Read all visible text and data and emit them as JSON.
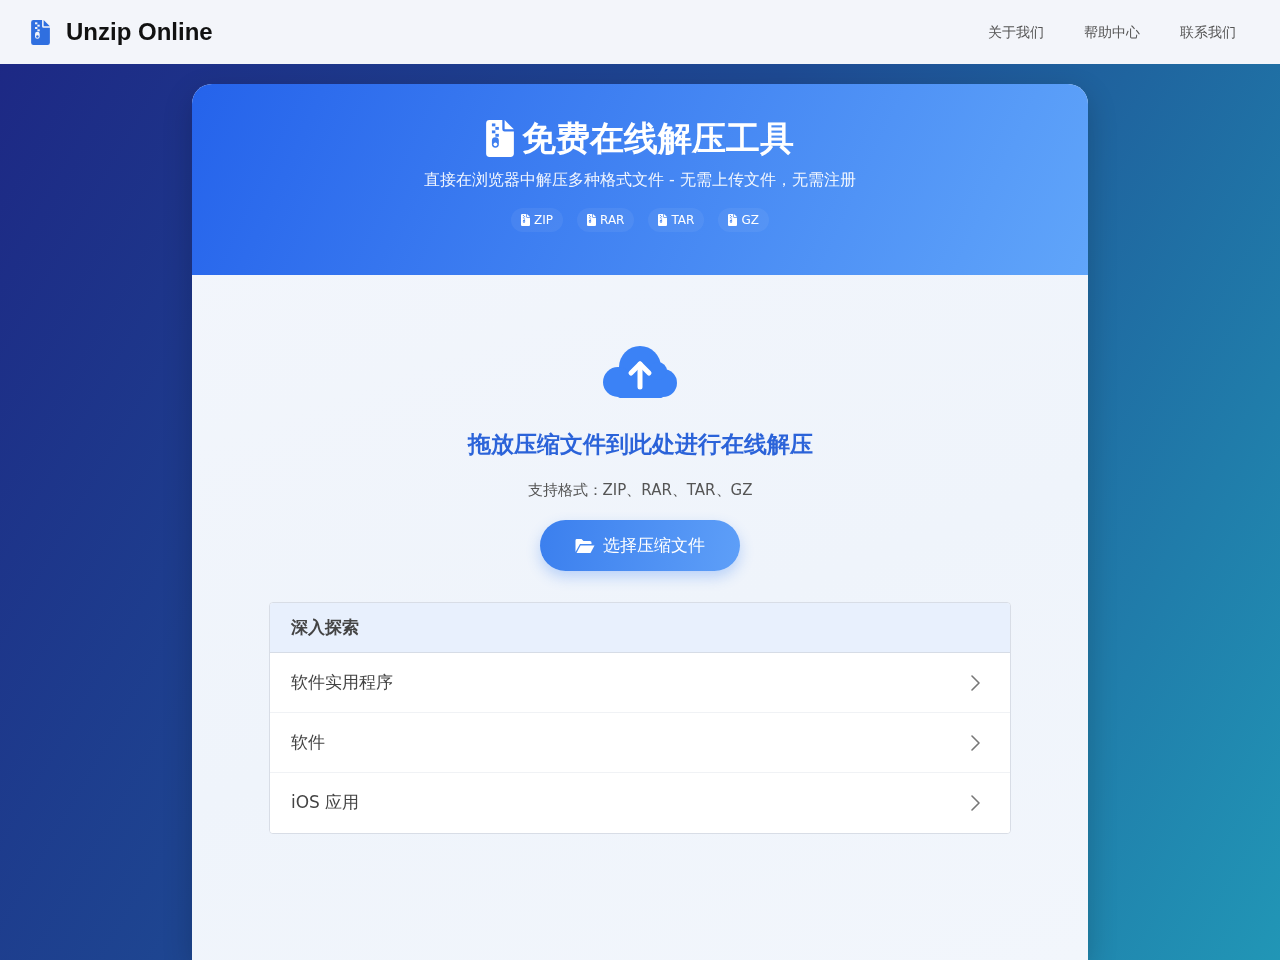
{
  "navbar": {
    "brand": "Unzip Online",
    "links": [
      "关于我们",
      "帮助中心",
      "联系我们"
    ]
  },
  "hero": {
    "title": "免费在线解压工具",
    "subtitle": "直接在浏览器中解压多种格式文件 - 无需上传文件，无需注册",
    "formats": [
      "ZIP",
      "RAR",
      "TAR",
      "GZ"
    ]
  },
  "dropzone": {
    "heading": "拖放压缩文件到此处进行在线解压",
    "hint": "支持格式：ZIP、RAR、TAR、GZ",
    "button": "选择压缩文件"
  },
  "explore": {
    "title": "深入探索",
    "items": [
      "软件实用程序",
      "软件",
      "iOS 应用"
    ]
  }
}
